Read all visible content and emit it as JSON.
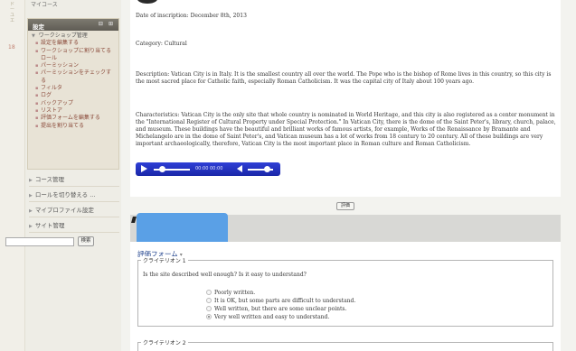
{
  "strip": {
    "vertical_text": "ドーユエ",
    "number": "18"
  },
  "sidebar": {
    "top_link": "マイコース",
    "settings_block": {
      "title": "設定",
      "controls": "⊟ ⊞",
      "root": "ワークショップ管理",
      "items": [
        "設定を編集する",
        "ワークショップに割り当てるロール",
        "パーミッション",
        "パーミッションをチェックする",
        "フィルタ",
        "ログ",
        "バックアップ",
        "リストア",
        "評価フォームを編集する",
        "提出を割り当てる"
      ]
    },
    "nav_items": [
      "コース管理",
      "ロールを切り替える ...",
      "マイプロファイル設定",
      "サイト管理"
    ],
    "search": {
      "value": "",
      "button": "検索"
    }
  },
  "submission": {
    "date": "Date of inscription: December 8th, 2013",
    "category": "Category: Cultural",
    "description": "Description: Vatican City is in Italy. It is the smallest country all over the world. The Pope who is the bishop of Rome lives in this country, so this city is the most sacred place for Catholic faith, especially Roman Catholicism. It was the capital city of Italy about 100 years ago.",
    "characteristics": "Characteristics: Vatican City is the only site that whole country is nominated in World Heritage, and this city is also registered as a center monument in the \"International Register of Cultural Property under Special Protection.\" In Vatican City, there is the dome of the Saint Peter's, library, church, palace, and museum. These buildings have the beautiful and brilliant works of famous artists, for example, Works of the Renaissance by Bramante and Michelangelo are in the dome of Saint Peter's, and Vatican museum has a lot of works from 18 century to 20 century. All of these buildings are very important archaeologically, therefore, Vatican City is the most important place in Roman culture and Roman Catholicism.",
    "player_time": "00:00  00:00",
    "center_button": "評価"
  },
  "assessment": {
    "title": "評価フォーム",
    "criterion1": {
      "legend": "クライテリオン 1",
      "question": "Is the site described well enough? Is it easy to understand?",
      "options": [
        "Poorly written.",
        "It is OK, but some parts are difficult to understand.",
        "Well written, but there are some unclear points.",
        "Very well written and easy to understand."
      ],
      "selected": 3
    },
    "criterion2": {
      "legend": "クライテリオン 2"
    }
  },
  "colors": {
    "player": "#1f2fc0",
    "highlight": "#5aa0e6",
    "link": "#1a3d8a",
    "sidebar_header": "#6e6b62"
  }
}
